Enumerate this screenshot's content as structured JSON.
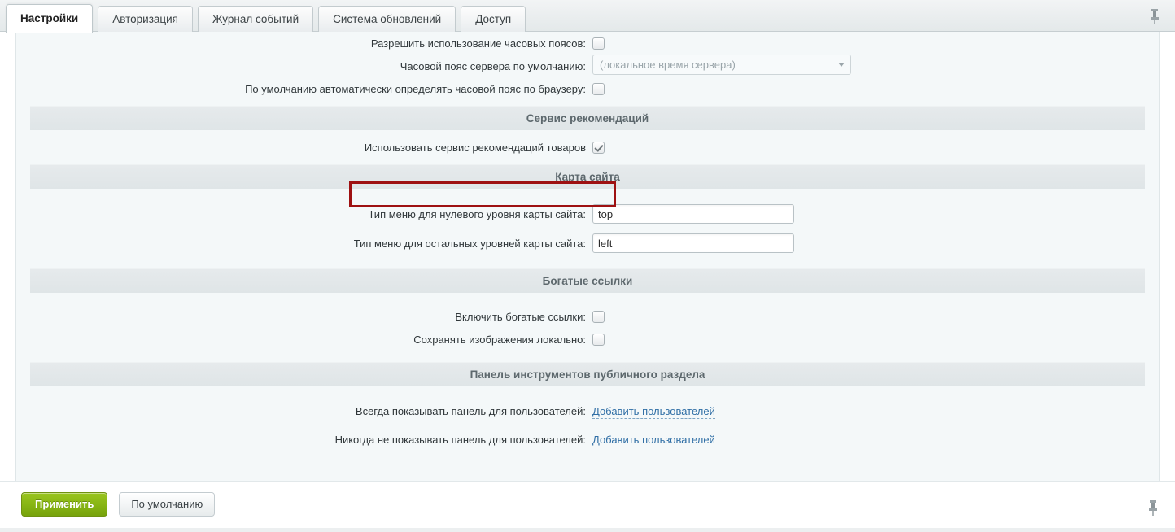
{
  "tabs": [
    {
      "label": "Настройки",
      "active": true
    },
    {
      "label": "Авторизация",
      "active": false
    },
    {
      "label": "Журнал событий",
      "active": false
    },
    {
      "label": "Система обновлений",
      "active": false
    },
    {
      "label": "Доступ",
      "active": false
    }
  ],
  "icons": {
    "pin_top": "pin-icon",
    "pin_bottom": "pin-icon"
  },
  "form": {
    "timezone": {
      "allow_timezones_label": "Разрешить использование часовых поясов:",
      "allow_timezones_checked": false,
      "server_timezone_label": "Часовой пояс сервера по умолчанию:",
      "server_timezone_value": "(локальное время сервера)",
      "autodetect_label": "По умолчанию автоматически определять часовой пояс по браузеру:",
      "autodetect_checked": false
    },
    "recommendations": {
      "section_title": "Сервис рекомендаций",
      "use_service_label": "Использовать сервис рекомендаций товаров",
      "use_service_checked": true
    },
    "sitemap": {
      "section_title": "Карта сайта",
      "zero_level_label": "Тип меню для нулевого уровня карты сайта:",
      "zero_level_value": "top",
      "other_levels_label": "Тип меню для остальных уровней карты сайта:",
      "other_levels_value": "left"
    },
    "rich_links": {
      "section_title": "Богатые ссылки",
      "enable_label": "Включить богатые ссылки:",
      "enable_checked": false,
      "save_images_label": "Сохранять изображения локально:",
      "save_images_checked": false
    },
    "public_toolbar": {
      "section_title": "Панель инструментов публичного раздела",
      "always_show_label": "Всегда показывать панель для пользователей:",
      "always_show_link": "Добавить пользователей",
      "never_show_label": "Никогда не показывать панель для пользователей:",
      "never_show_link": "Добавить пользователей"
    }
  },
  "footer": {
    "apply_label": "Применить",
    "default_label": "По умолчанию"
  },
  "colors": {
    "accent_green": "#86b413",
    "highlight_red": "#9e1112",
    "link_blue": "#2f6ea5",
    "band_gray": "#e3e8ea",
    "page_bg": "#f4f8f9"
  }
}
